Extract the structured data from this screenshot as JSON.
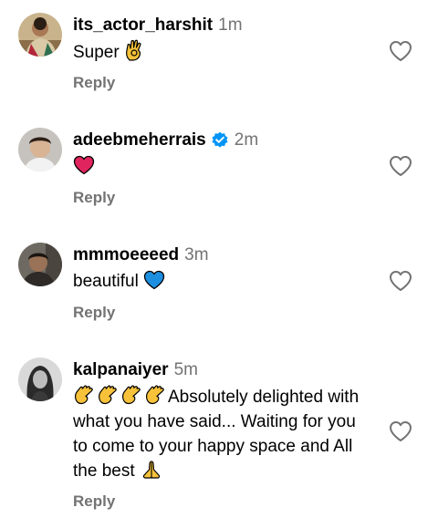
{
  "comments": [
    {
      "username": "its_actor_harshit",
      "time": "1m",
      "text": "Super",
      "emoji_trailing": "ok-hand",
      "reply_label": "Reply",
      "verified": false
    },
    {
      "username": "adeebmeherrais",
      "time": "2m",
      "text": "",
      "emoji_trailing": "red-heart",
      "reply_label": "Reply",
      "verified": true
    },
    {
      "username": "mmmoeeeed",
      "time": "3m",
      "text": "beautiful",
      "emoji_trailing": "blue-heart",
      "reply_label": "Reply",
      "verified": false
    },
    {
      "username": "kalpanaiyer",
      "time": "5m",
      "emoji_leading": [
        "clapping-hands",
        "clapping-hands",
        "clapping-hands",
        "clapping-hands"
      ],
      "text_line1": "Absolutely delighted",
      "text_rest": "with what you have said... Waiting for you to come to your happy space and All the best",
      "emoji_trailing": "folded-hands",
      "reply_label": "Reply",
      "verified": false
    }
  ],
  "colors": {
    "secondary_text": "#737373",
    "verified_badge": "#0095f6",
    "red_heart": "#e0245e",
    "blue_heart": "#1d8fe1",
    "emoji_yellow": "#f7c23a"
  },
  "icons": {
    "like": "heart-outline-icon",
    "verified": "verified-badge-icon"
  }
}
